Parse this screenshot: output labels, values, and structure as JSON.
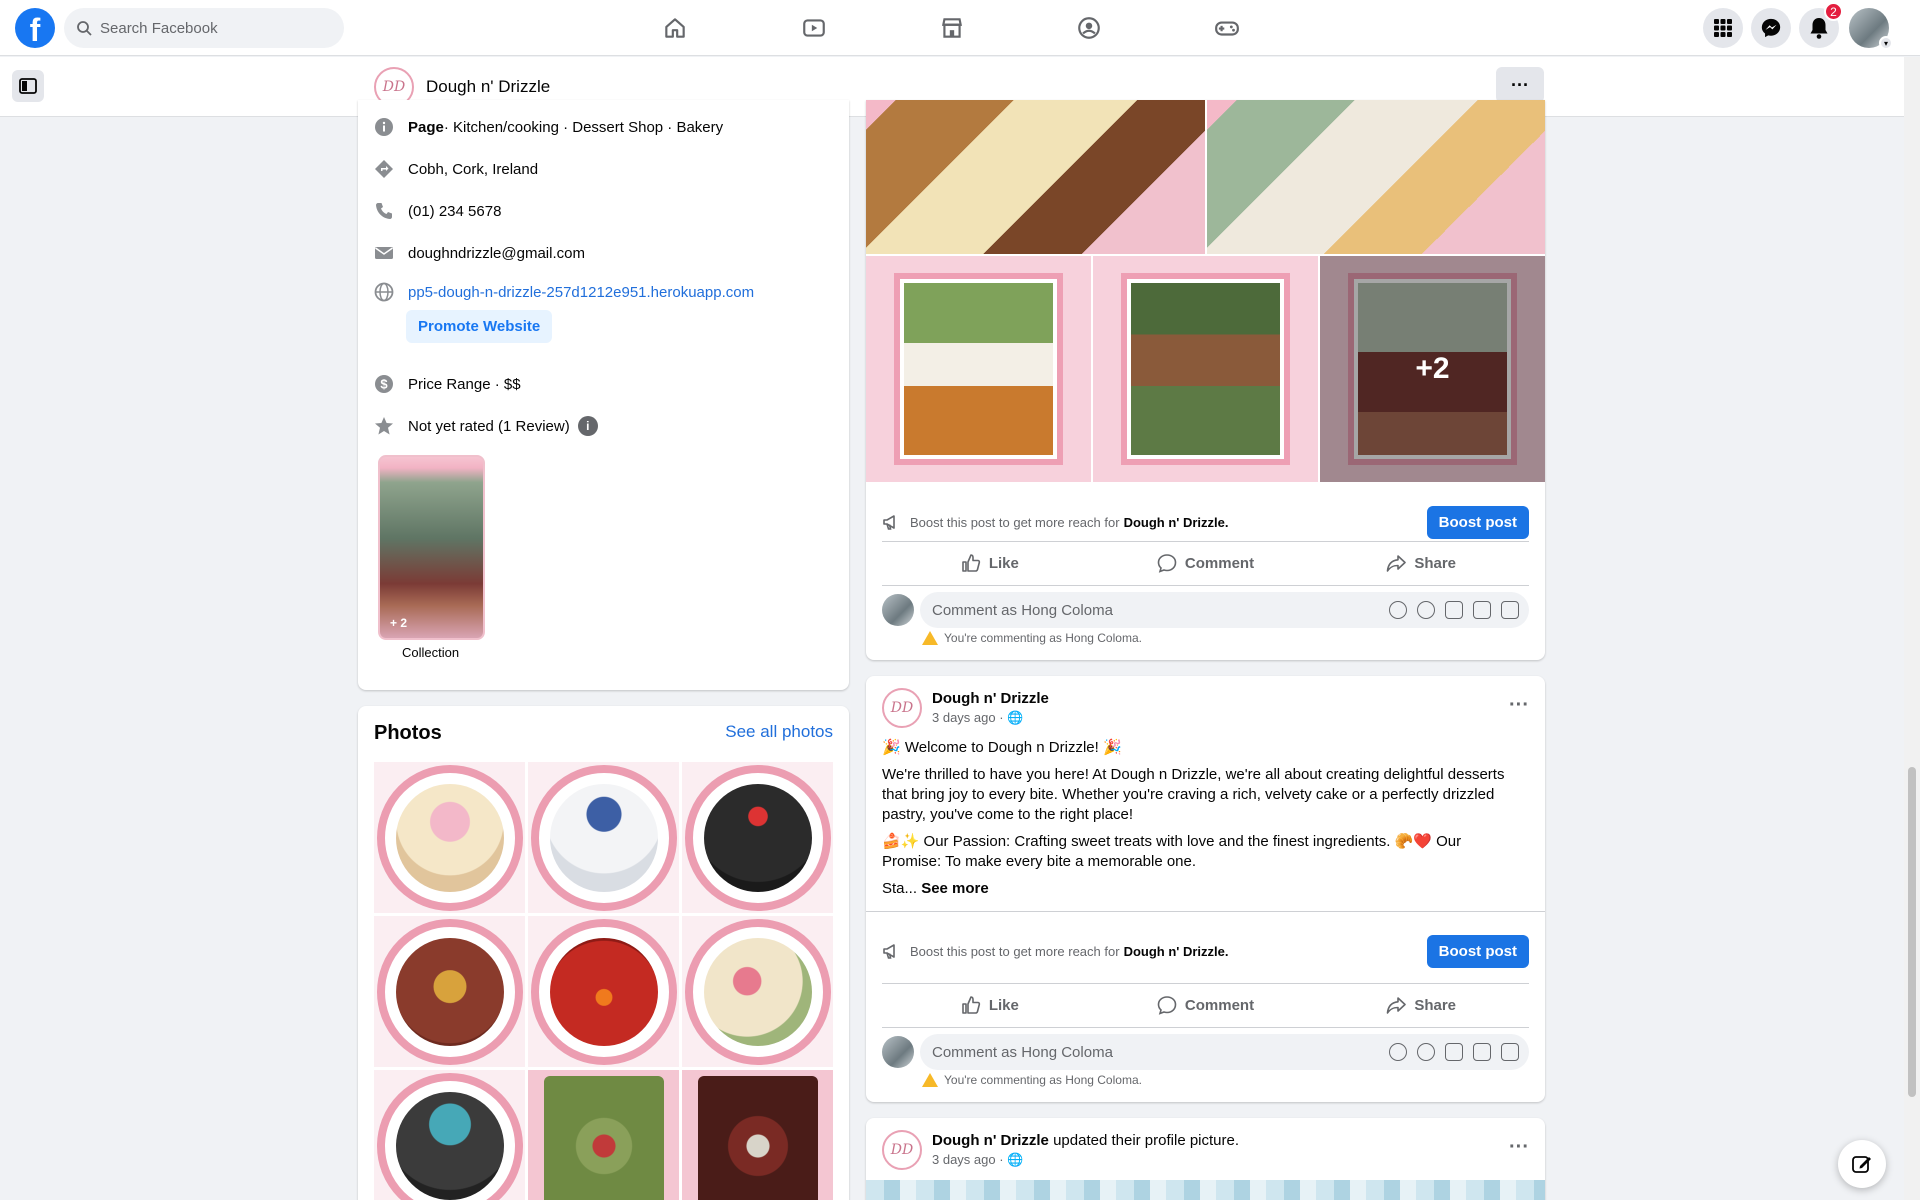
{
  "topbar": {
    "logo": "f",
    "search_placeholder": "Search Facebook",
    "nav_icons": [
      "home-icon",
      "watch-icon",
      "marketplace-icon",
      "groups-icon",
      "gaming-icon"
    ],
    "notifications_count": "2"
  },
  "pagebar": {
    "logo_text": "DD",
    "page_name": "Dough n' Drizzle",
    "more_label": "···"
  },
  "intro": {
    "category_prefix": "Page",
    "category": " · Kitchen/cooking · Dessert Shop · Bakery",
    "address": "Cobh, Cork, Ireland",
    "phone": "(01) 234 5678",
    "email": "doughndrizzle@gmail.com",
    "website": "pp5-dough-n-drizzle-257d1212e951.herokuapp.com",
    "promote_label": "Promote Website",
    "price_range": "Price Range · $$",
    "rating": "Not yet rated (1 Review)",
    "rating_info": "i",
    "collection_count": "+ 2",
    "collection_label": "Collection"
  },
  "photos": {
    "title": "Photos",
    "see_all": "See all photos",
    "items": [
      {
        "name": "unicorn-cake",
        "color": "#e9c9a8"
      },
      {
        "name": "paw-patrol-cake",
        "color": "#dfe6ef"
      },
      {
        "name": "jordan-cake",
        "color": "#2b2b2b"
      },
      {
        "name": "iron-man-cake",
        "color": "#8a3b2c"
      },
      {
        "name": "elmo-cake",
        "color": "#b5241f"
      },
      {
        "name": "floral-cake",
        "color": "#e8d9b8"
      },
      {
        "name": "demon-slayer-cake",
        "color": "#3b3b3b"
      },
      {
        "name": "matcha-box",
        "color": "#8aa05a"
      },
      {
        "name": "strawberry-box",
        "color": "#6b2a22"
      }
    ]
  },
  "post1": {
    "gallery_more": "+2",
    "boost_text": "Boost this post to get more reach for",
    "boost_page": "Dough n' Drizzle.",
    "boost_button": "Boost post",
    "like": "Like",
    "comment": "Comment",
    "share": "Share",
    "comment_placeholder": "Comment as Hong Coloma",
    "commenting_as": "You're commenting as Hong Coloma."
  },
  "post2": {
    "author": "Dough n' Drizzle",
    "time": "3 days ago · 🌐",
    "line1": "🎉 Welcome to Dough n Drizzle! 🎉",
    "line2": "We're thrilled to have you here! At Dough n Drizzle, we're all about creating delightful desserts that bring joy to every bite. Whether you're craving a rich, velvety cake or a perfectly drizzled pastry, you've come to the right place!",
    "line3": "🍰✨ Our Passion: Crafting sweet treats with love and the finest ingredients. 🥐❤️ Our Promise: To make every bite a memorable one.",
    "line4_prefix": "Sta... ",
    "see_more": "See more",
    "boost_text": "Boost this post to get more reach for",
    "boost_page": "Dough n' Drizzle.",
    "boost_button": "Boost post",
    "like": "Like",
    "comment": "Comment",
    "share": "Share",
    "comment_placeholder": "Comment as Hong Coloma",
    "commenting_as": "You're commenting as Hong Coloma."
  },
  "post3": {
    "author": "Dough n' Drizzle",
    "action": " updated their profile picture.",
    "time": "3 days ago · 🌐"
  },
  "colors": {
    "facebook_blue": "#1877f2",
    "boost_blue": "#1b74e4",
    "brand_pink": "#ec9db1",
    "badge_red": "#e41e3f"
  }
}
